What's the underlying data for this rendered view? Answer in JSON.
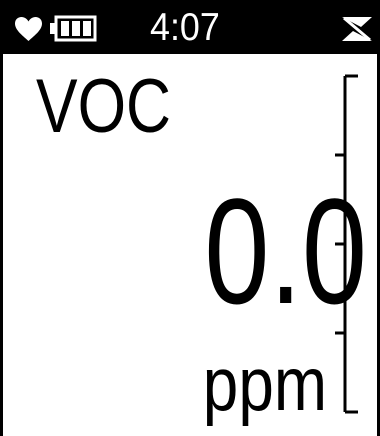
{
  "status_bar": {
    "time": "4:07",
    "icons": [
      "heart-icon",
      "battery-icon",
      "signal-icon"
    ],
    "battery_level": 1.0
  },
  "reading": {
    "gas_name": "VOC",
    "value": "0.0",
    "unit": "ppm",
    "bar_level": 0.0
  },
  "colors": {
    "background": "#ffffff",
    "foreground": "#000000",
    "status_bar": "#000000"
  }
}
